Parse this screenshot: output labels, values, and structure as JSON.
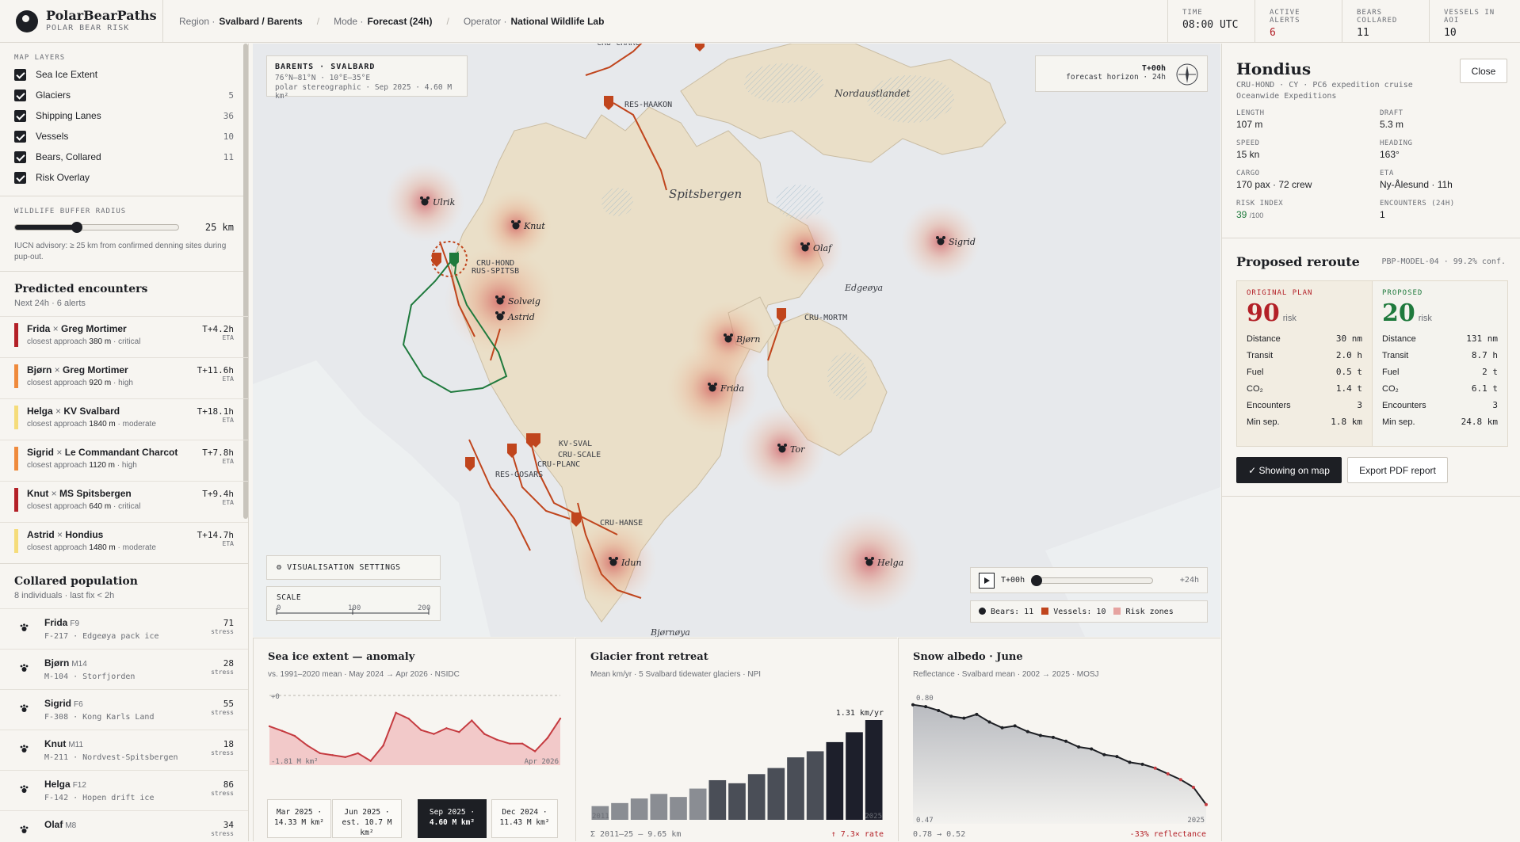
{
  "brand": {
    "name": "PolarBearPaths",
    "subtitle": "POLAR BEAR RISK"
  },
  "crumbs": [
    {
      "k": "Region ·",
      "v": "Svalbard / Barents"
    },
    {
      "k": "Mode ·",
      "v": "Forecast (24h)"
    },
    {
      "k": "Operator ·",
      "v": "National Wildlife Lab"
    }
  ],
  "stats": [
    {
      "k": "TIME",
      "v": "08:00 UTC",
      "color": "#1d1f24"
    },
    {
      "k": "ACTIVE ALERTS",
      "v": "6",
      "color": "#b32027"
    },
    {
      "k": "BEARS COLLARED",
      "v": "11",
      "color": "#1d1f24"
    },
    {
      "k": "VESSELS IN AOI",
      "v": "10",
      "color": "#1d1f24"
    }
  ],
  "layers": {
    "title": "MAP LAYERS",
    "items": [
      {
        "label": "Sea Ice Extent",
        "count": ""
      },
      {
        "label": "Glaciers",
        "count": "5"
      },
      {
        "label": "Shipping Lanes",
        "count": "36"
      },
      {
        "label": "Vessels",
        "count": "10"
      },
      {
        "label": "Bears, Collared",
        "count": "11"
      },
      {
        "label": "Risk Overlay",
        "count": ""
      }
    ]
  },
  "buffer": {
    "title": "WILDLIFE BUFFER RADIUS",
    "value": "25 km",
    "level": 0.38,
    "note": "IUCN advisory: ≥ 25 km from confirmed denning sites during pup-out."
  },
  "encounters": {
    "title": "Predicted encounters",
    "sub": "Next 24h · 6 alerts",
    "items": [
      {
        "bear": "Frida",
        "vessel": "Greg Mortimer",
        "dist": "380 m",
        "sev": "critical",
        "eta": "T+4.2h",
        "color": "#b32027"
      },
      {
        "bear": "Bjørn",
        "vessel": "Greg Mortimer",
        "dist": "920 m",
        "sev": "high",
        "eta": "T+11.6h",
        "color": "#ef8a3c"
      },
      {
        "bear": "Helga",
        "vessel": "KV Svalbard",
        "dist": "1840 m",
        "sev": "moderate",
        "eta": "T+18.1h",
        "color": "#f5dc7a"
      },
      {
        "bear": "Sigrid",
        "vessel": "Le Commandant Charcot",
        "dist": "1120 m",
        "sev": "high",
        "eta": "T+7.8h",
        "color": "#ef8a3c"
      },
      {
        "bear": "Knut",
        "vessel": "MS Spitsbergen",
        "dist": "640 m",
        "sev": "critical",
        "eta": "T+9.4h",
        "color": "#b32027"
      },
      {
        "bear": "Astrid",
        "vessel": "Hondius",
        "dist": "1480 m",
        "sev": "moderate",
        "eta": "T+14.7h",
        "color": "#f5dc7a"
      }
    ],
    "approach": "closest approach",
    "eta_label": "ETA",
    "x": " × "
  },
  "population": {
    "title": "Collared population",
    "sub": "8 individuals · last fix < 2h",
    "stress_label": "stress",
    "items": [
      {
        "name": "Frida",
        "tag": "F9",
        "id": "F-217 · Edgeøya pack ice",
        "stress": "71"
      },
      {
        "name": "Bjørn",
        "tag": "M14",
        "id": "M-104 · Storfjorden",
        "stress": "28"
      },
      {
        "name": "Sigrid",
        "tag": "F6",
        "id": "F-308 · Kong Karls Land",
        "stress": "55"
      },
      {
        "name": "Knut",
        "tag": "M11",
        "id": "M-211 · Nordvest-Spitsbergen",
        "stress": "18"
      },
      {
        "name": "Helga",
        "tag": "F12",
        "id": "F-142 · Hopen drift ice",
        "stress": "86"
      },
      {
        "name": "Olaf",
        "tag": "M8",
        "id": "",
        "stress": "34"
      }
    ]
  },
  "map": {
    "header": {
      "title": "BARENTS · SVALBARD",
      "coords": "76°N–81°N · 10°E–35°E",
      "proj": "polar stereographic · Sep 2025 · 4.60 M km²"
    },
    "horizon": {
      "t": "T+00h",
      "label": "forecast horizon · 24h"
    },
    "places": [
      "Nordaustlandet",
      "Spitsbergen",
      "Edgeøya",
      "Bjørnøya"
    ],
    "bears": [
      "Ulrik",
      "Knut",
      "Solveig",
      "Astrid",
      "Olaf",
      "Sigrid",
      "Bjørn",
      "Frida",
      "Tor",
      "Idun",
      "Helga"
    ],
    "vessels": [
      "CRU-CHARC",
      "RES-HAAKON",
      "CRU-HOND",
      "RUS-SPITSB",
      "CRU-MORTM",
      "KV-SVAL",
      "CRU-SCALE",
      "CRU-PLANC",
      "RES-GOSARS",
      "CRU-HANSE"
    ],
    "vis_settings": "VISUALISATION SETTINGS",
    "scale": {
      "label": "SCALE",
      "ticks": [
        "0",
        "100",
        "200"
      ]
    },
    "timeline": {
      "start": "T+00h",
      "end": "+24h",
      "level": 0.0
    },
    "legend": [
      {
        "label": "Bears: 11",
        "color": "#1d1f24"
      },
      {
        "label": "Vessels: 10",
        "color": "#c0451d"
      },
      {
        "label": "Risk zones",
        "color": "#e6a3a0"
      }
    ]
  },
  "vessel": {
    "name": "Hondius",
    "line1": "CRU-HOND · CY · PC6 expedition cruise",
    "line2": "Oceanwide Expeditions",
    "close": "Close",
    "fields": [
      {
        "k": "LENGTH",
        "v": "107 m"
      },
      {
        "k": "DRAFT",
        "v": "5.3 m"
      },
      {
        "k": "SPEED",
        "v": "15 kn"
      },
      {
        "k": "HEADING",
        "v": "163°"
      },
      {
        "k": "CARGO",
        "v": "170 pax · 72 crew"
      },
      {
        "k": "ETA",
        "v": "Ny-Ålesund · 11h"
      },
      {
        "k": "RISK INDEX",
        "v": "39",
        "unit": "/100"
      },
      {
        "k": "ENCOUNTERS (24H)",
        "v": "1"
      }
    ]
  },
  "reroute": {
    "title": "Proposed reroute",
    "model": "PBP-MODEL-04 · 99.2% conf.",
    "risk_unit": "risk",
    "original": {
      "label": "ORIGINAL PLAN",
      "risk": "90",
      "color": "#b32027",
      "rows": [
        [
          "Distance",
          "30 nm"
        ],
        [
          "Transit",
          "2.0 h"
        ],
        [
          "Fuel",
          "0.5 t"
        ],
        [
          "CO₂",
          "1.4 t"
        ],
        [
          "Encounters",
          "3"
        ],
        [
          "Min sep.",
          "1.8 km"
        ]
      ]
    },
    "proposed": {
      "label": "PROPOSED",
      "risk": "20",
      "color": "#1f7a3d",
      "rows": [
        [
          "Distance",
          "131 nm"
        ],
        [
          "Transit",
          "8.7 h"
        ],
        [
          "Fuel",
          "2 t"
        ],
        [
          "CO₂",
          "6.1 t"
        ],
        [
          "Encounters",
          "3"
        ],
        [
          "Min sep.",
          "24.8 km"
        ]
      ]
    },
    "show_btn": "✓ Showing on map",
    "pdf_btn": "Export PDF report"
  },
  "chart_data": [
    {
      "type": "area",
      "title": "Sea ice extent — anomaly",
      "subtitle": "vs. 1991–2020 mean · May 2024 → Apr 2026 · NSIDC",
      "x": [
        "May 2024",
        "Jun 2024",
        "Jul 2024",
        "Aug 2024",
        "Sep 2024",
        "Oct 2024",
        "Nov 2024",
        "Dec 2024",
        "Jan 2025",
        "Feb 2025",
        "Mar 2025",
        "Apr 2025",
        "May 2025",
        "Jun 2025",
        "Jul 2025",
        "Aug 2025",
        "Sep 2025",
        "Oct 2025",
        "Nov 2025",
        "Dec 2025",
        "Jan 2026",
        "Feb 2026",
        "Mar 2026",
        "Apr 2026"
      ],
      "values": [
        -0.8,
        -0.92,
        -1.05,
        -1.3,
        -1.5,
        -1.55,
        -1.6,
        -1.5,
        -1.7,
        -1.3,
        -0.45,
        -0.6,
        -0.9,
        -1.0,
        -0.85,
        -0.95,
        -0.65,
        -1.0,
        -1.15,
        -1.25,
        -1.25,
        -1.45,
        -1.1,
        -0.6
      ],
      "ylim": [
        -1.81,
        0
      ],
      "top_label": "+0",
      "bottom_label": "-1.81 M km²",
      "end_label": "Apr 2026",
      "snapshots": [
        {
          "a": "Mar 2025 ·",
          "b": "14.33 M km²"
        },
        {
          "a": "Jun 2025 ·",
          "b": "est. 10.7 M",
          "c": "km²"
        },
        {
          "a": "Sep 2025 ·",
          "b": "4.60 M km²",
          "active": true
        },
        {
          "a": "Dec 2024 ·",
          "b": "11.43 M km²"
        }
      ]
    },
    {
      "type": "bar",
      "title": "Glacier front retreat",
      "subtitle": "Mean km/yr · 5 Svalbard tidewater glaciers · NPI",
      "categories": [
        "2011",
        "2012",
        "2013",
        "2014",
        "2015",
        "2016",
        "2017",
        "2018",
        "2019",
        "2020",
        "2021",
        "2022",
        "2023",
        "2024",
        "2025"
      ],
      "values": [
        0.18,
        0.22,
        0.28,
        0.34,
        0.3,
        0.41,
        0.52,
        0.48,
        0.6,
        0.68,
        0.82,
        0.9,
        1.02,
        1.15,
        1.31
      ],
      "ylim": [
        0,
        1.31
      ],
      "max_label": "1.31 km/yr",
      "first_label": "2011",
      "last_label": "2025",
      "footer": "Σ 2011–25 — 9.65 km",
      "rate": "↑ 7.3× rate"
    },
    {
      "type": "line",
      "title": "Snow albedo · June",
      "subtitle": "Reflectance · Svalbard mean · 2002 → 2025 · MOSJ",
      "x": [
        "2002",
        "2003",
        "2004",
        "2005",
        "2006",
        "2007",
        "2008",
        "2009",
        "2010",
        "2011",
        "2012",
        "2013",
        "2014",
        "2015",
        "2016",
        "2017",
        "2018",
        "2019",
        "2020",
        "2021",
        "2022",
        "2023",
        "2024",
        "2025"
      ],
      "values": [
        0.78,
        0.775,
        0.765,
        0.75,
        0.745,
        0.755,
        0.735,
        0.72,
        0.725,
        0.71,
        0.7,
        0.695,
        0.685,
        0.67,
        0.665,
        0.65,
        0.645,
        0.63,
        0.625,
        0.615,
        0.6,
        0.585,
        0.565,
        0.52
      ],
      "ylim": [
        0.47,
        0.8
      ],
      "top_label": "0.80",
      "bottom_label": "0.47",
      "end_label": "2025",
      "footer": "0.78 → 0.52",
      "rate": "-33% reflectance"
    }
  ]
}
